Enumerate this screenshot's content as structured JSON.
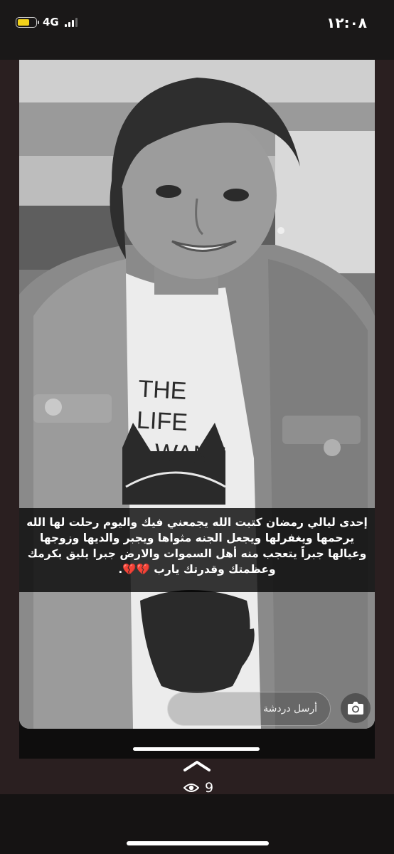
{
  "status_bar": {
    "clock": "١٢:٠٨",
    "network": "4G",
    "battery_fraction": 0.6
  },
  "story": {
    "photo_subject": "girl-in-jacket-photo",
    "shirt_text_line1": "THE LIFE",
    "shirt_text_line2": "WANT",
    "caption": "إحدى ليالي رمضان كتبت الله يجمعني فيك واليوم رحلت لها الله يرحمها ويغفرلها ويجعل الجنه مثواها ويجبر والديها وزوجها وعيالها جبراً يتعجب منه أهل السموات والارض جبرا يليق بكرمك وعظمتك وقدرتك يارب 💔💔.",
    "chat_placeholder": "أرسل دردشة"
  },
  "footer": {
    "view_count": "9"
  },
  "icons": {
    "camera": "camera-icon",
    "eye": "eye-icon",
    "chevron": "chevron-up-icon"
  }
}
